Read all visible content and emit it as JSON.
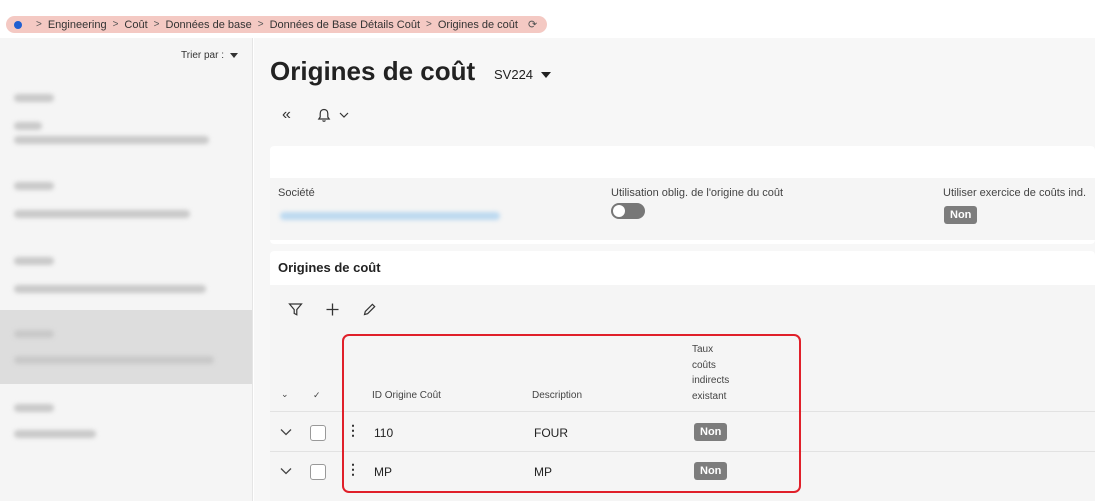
{
  "breadcrumb": {
    "items": [
      "Engineering",
      "Coût",
      "Données de base",
      "Données de Base Détails Coût",
      "Origines de coût"
    ],
    "separator": ">"
  },
  "sidebar": {
    "sort_label": "Trier par :"
  },
  "page": {
    "title": "Origines de coût",
    "subtitle": "SV224"
  },
  "header_panel": {
    "societe_label": "Société",
    "utilisation_label": "Utilisation oblig. de l'origine du coût",
    "exercice_label": "Utiliser exercice de coûts ind.",
    "exercice_value": "Non"
  },
  "grid": {
    "title": "Origines de coût",
    "columns": {
      "id": "ID Origine Coût",
      "description": "Description",
      "taux": [
        "Taux",
        "coûts",
        "indirects",
        "existant"
      ]
    },
    "rows": [
      {
        "id": "110",
        "description": "FOUR",
        "taux": "Non"
      },
      {
        "id": "MP",
        "description": "MP",
        "taux": "Non"
      }
    ]
  },
  "colors": {
    "breadcrumb_bg": "#f4c9c3",
    "breadcrumb_dot": "#1f5fd1",
    "badge_bg": "#7d7d7d",
    "highlight": "#e0202a",
    "link_blur": "#bcd9f0"
  },
  "icons": {
    "collapse": "double-chevron-left-icon",
    "notification": "bell-icon",
    "filter": "filter-icon",
    "add": "plus-icon",
    "edit": "pencil-icon"
  }
}
